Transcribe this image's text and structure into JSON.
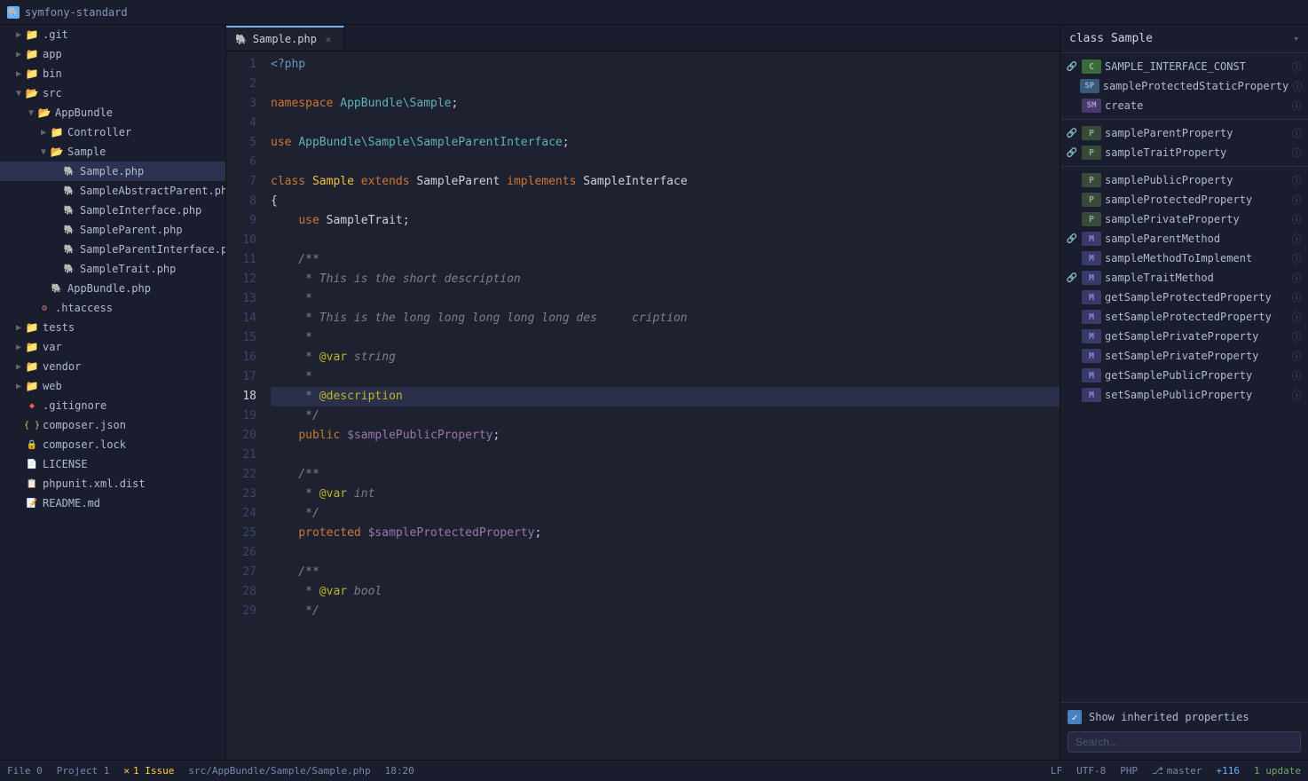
{
  "titleBar": {
    "icon": "🐘",
    "title": "symfony-standard"
  },
  "sidebar": {
    "items": [
      {
        "id": "git",
        "label": ".git",
        "indent": 1,
        "type": "folder",
        "collapsed": true,
        "arrow": "▶"
      },
      {
        "id": "app",
        "label": "app",
        "indent": 1,
        "type": "folder",
        "collapsed": true,
        "arrow": "▶"
      },
      {
        "id": "bin",
        "label": "bin",
        "indent": 1,
        "type": "folder",
        "collapsed": true,
        "arrow": "▶"
      },
      {
        "id": "src",
        "label": "src",
        "indent": 1,
        "type": "folder-open",
        "collapsed": false,
        "arrow": "▼"
      },
      {
        "id": "appbundle",
        "label": "AppBundle",
        "indent": 2,
        "type": "folder-open",
        "collapsed": false,
        "arrow": "▼"
      },
      {
        "id": "controller",
        "label": "Controller",
        "indent": 3,
        "type": "folder",
        "collapsed": true,
        "arrow": "▶"
      },
      {
        "id": "sample-dir",
        "label": "Sample",
        "indent": 3,
        "type": "folder-open",
        "collapsed": false,
        "arrow": "▼"
      },
      {
        "id": "sample-php",
        "label": "Sample.php",
        "indent": 4,
        "type": "php",
        "active": true
      },
      {
        "id": "sampleabstractparent",
        "label": "SampleAbstractParent.php",
        "indent": 4,
        "type": "php"
      },
      {
        "id": "sampleinterface",
        "label": "SampleInterface.php",
        "indent": 4,
        "type": "php"
      },
      {
        "id": "sampleparent",
        "label": "SampleParent.php",
        "indent": 4,
        "type": "php"
      },
      {
        "id": "sampleparentinterface",
        "label": "SampleParentInterface.php",
        "indent": 4,
        "type": "php"
      },
      {
        "id": "sampletrait",
        "label": "SampleTrait.php",
        "indent": 4,
        "type": "php"
      },
      {
        "id": "appbundle-php",
        "label": "AppBundle.php",
        "indent": 3,
        "type": "php"
      },
      {
        "id": "htaccess",
        "label": ".htaccess",
        "indent": 2,
        "type": "htaccess"
      },
      {
        "id": "tests",
        "label": "tests",
        "indent": 1,
        "type": "folder",
        "collapsed": true,
        "arrow": "▶"
      },
      {
        "id": "var",
        "label": "var",
        "indent": 1,
        "type": "folder",
        "collapsed": true,
        "arrow": "▶"
      },
      {
        "id": "vendor",
        "label": "vendor",
        "indent": 1,
        "type": "folder",
        "collapsed": true,
        "arrow": "▶"
      },
      {
        "id": "web",
        "label": "web",
        "indent": 1,
        "type": "folder",
        "collapsed": true,
        "arrow": "▶"
      },
      {
        "id": "gitignore",
        "label": ".gitignore",
        "indent": 1,
        "type": "git"
      },
      {
        "id": "composerjson",
        "label": "composer.json",
        "indent": 1,
        "type": "json"
      },
      {
        "id": "composerlock",
        "label": "composer.lock",
        "indent": 1,
        "type": "lock"
      },
      {
        "id": "license",
        "label": "LICENSE",
        "indent": 1,
        "type": "txt"
      },
      {
        "id": "phpunit",
        "label": "phpunit.xml.dist",
        "indent": 1,
        "type": "xml"
      },
      {
        "id": "readme",
        "label": "README.md",
        "indent": 1,
        "type": "md"
      }
    ]
  },
  "tabs": [
    {
      "id": "sample-php",
      "label": "Sample.php",
      "active": true,
      "icon": "🐘"
    }
  ],
  "codeLines": [
    {
      "num": 1,
      "content": "<?php",
      "tokens": [
        {
          "type": "tag",
          "text": "<?php"
        }
      ]
    },
    {
      "num": 2,
      "content": "",
      "tokens": []
    },
    {
      "num": 3,
      "content": "namespace AppBundle\\Sample;",
      "tokens": [
        {
          "type": "kw",
          "text": "namespace"
        },
        {
          "type": "plain",
          "text": " "
        },
        {
          "type": "ns",
          "text": "AppBundle\\Sample"
        },
        {
          "type": "plain",
          "text": ";"
        }
      ]
    },
    {
      "num": 4,
      "content": "",
      "tokens": []
    },
    {
      "num": 5,
      "content": "use AppBundle\\Sample\\SampleParentInterface;",
      "tokens": [
        {
          "type": "kw",
          "text": "use"
        },
        {
          "type": "plain",
          "text": " "
        },
        {
          "type": "ns",
          "text": "AppBundle\\Sample\\SampleParentInterface"
        },
        {
          "type": "plain",
          "text": ";"
        }
      ]
    },
    {
      "num": 6,
      "content": "",
      "tokens": []
    },
    {
      "num": 7,
      "content": "class Sample extends SampleParent implements SampleInterface",
      "tokens": [
        {
          "type": "kw",
          "text": "class"
        },
        {
          "type": "plain",
          "text": " "
        },
        {
          "type": "cls",
          "text": "Sample"
        },
        {
          "type": "plain",
          "text": " "
        },
        {
          "type": "kw",
          "text": "extends"
        },
        {
          "type": "plain",
          "text": " SampleParent "
        },
        {
          "type": "kw",
          "text": "implements"
        },
        {
          "type": "plain",
          "text": " SampleInterface"
        }
      ]
    },
    {
      "num": 8,
      "content": "{",
      "tokens": [
        {
          "type": "plain",
          "text": "{"
        }
      ]
    },
    {
      "num": 9,
      "content": "    use SampleTrait;",
      "tokens": [
        {
          "type": "plain",
          "text": "    "
        },
        {
          "type": "kw",
          "text": "use"
        },
        {
          "type": "plain",
          "text": " SampleTrait;"
        }
      ]
    },
    {
      "num": 10,
      "content": "",
      "tokens": []
    },
    {
      "num": 11,
      "content": "    /**",
      "tokens": [
        {
          "type": "cmnt",
          "text": "    /**"
        }
      ]
    },
    {
      "num": 12,
      "content": "     * This is the short description",
      "tokens": [
        {
          "type": "cmnt",
          "text": "     * This is the short description"
        }
      ]
    },
    {
      "num": 13,
      "content": "     *",
      "tokens": [
        {
          "type": "cmnt",
          "text": "     *"
        }
      ]
    },
    {
      "num": 14,
      "content": "     * This is the long long long long long des     cription",
      "tokens": [
        {
          "type": "cmnt",
          "text": "     * This is the long long long long long des     cription"
        }
      ]
    },
    {
      "num": 15,
      "content": "     *",
      "tokens": [
        {
          "type": "cmnt",
          "text": "     *"
        }
      ]
    },
    {
      "num": 16,
      "content": "     * @var string",
      "tokens": [
        {
          "type": "cmnt",
          "text": "     * "
        },
        {
          "type": "ann",
          "text": "@var"
        },
        {
          "type": "cmnt",
          "text": " string"
        }
      ]
    },
    {
      "num": 17,
      "content": "     *",
      "tokens": [
        {
          "type": "cmnt",
          "text": "     *"
        }
      ]
    },
    {
      "num": 18,
      "content": "     * @description",
      "tokens": [
        {
          "type": "cmnt",
          "text": "     * "
        },
        {
          "type": "ann",
          "text": "@description"
        }
      ],
      "highlighted": true
    },
    {
      "num": 19,
      "content": "     */",
      "tokens": [
        {
          "type": "cmnt",
          "text": "     */"
        }
      ]
    },
    {
      "num": 20,
      "content": "    public $samplePublicProperty;",
      "tokens": [
        {
          "type": "plain",
          "text": "    "
        },
        {
          "type": "kw",
          "text": "public"
        },
        {
          "type": "plain",
          "text": " "
        },
        {
          "type": "var",
          "text": "$samplePublicProperty"
        },
        {
          "type": "plain",
          "text": ";"
        }
      ]
    },
    {
      "num": 21,
      "content": "",
      "tokens": []
    },
    {
      "num": 22,
      "content": "    /**",
      "tokens": [
        {
          "type": "cmnt",
          "text": "    /**"
        }
      ]
    },
    {
      "num": 23,
      "content": "     * @var int",
      "tokens": [
        {
          "type": "cmnt",
          "text": "     * "
        },
        {
          "type": "ann",
          "text": "@var"
        },
        {
          "type": "cmnt",
          "text": " int"
        }
      ]
    },
    {
      "num": 24,
      "content": "     */",
      "tokens": [
        {
          "type": "cmnt",
          "text": "     */"
        }
      ]
    },
    {
      "num": 25,
      "content": "    protected $sampleProtectedProperty;",
      "tokens": [
        {
          "type": "plain",
          "text": "    "
        },
        {
          "type": "kw",
          "text": "protected"
        },
        {
          "type": "plain",
          "text": " "
        },
        {
          "type": "var",
          "text": "$sampleProtectedProperty"
        },
        {
          "type": "plain",
          "text": ";"
        }
      ]
    },
    {
      "num": 26,
      "content": "",
      "tokens": []
    },
    {
      "num": 27,
      "content": "    /**",
      "tokens": [
        {
          "type": "cmnt",
          "text": "    /**"
        }
      ]
    },
    {
      "num": 28,
      "content": "     * @var bool",
      "tokens": [
        {
          "type": "cmnt",
          "text": "     * "
        },
        {
          "type": "ann",
          "text": "@var"
        },
        {
          "type": "cmnt",
          "text": " bool"
        }
      ]
    },
    {
      "num": 29,
      "content": "     */",
      "tokens": [
        {
          "type": "cmnt",
          "text": "     */"
        }
      ]
    }
  ],
  "rightPanel": {
    "title": "class Sample",
    "symbols": [
      {
        "id": "SAMPLE_INTERFACE_CONST",
        "badge": "C",
        "badgeClass": "badge-c",
        "name": "SAMPLE_INTERFACE_CONST",
        "hasLink": true,
        "hasInfo": true
      },
      {
        "id": "sampleProtectedStaticProperty",
        "badge": "SP",
        "badgeClass": "badge-sp",
        "name": "sampleProtectedStaticProperty",
        "hasLink": false,
        "hasInfo": true
      },
      {
        "id": "create",
        "badge": "SM",
        "badgeClass": "badge-sm",
        "name": "create",
        "hasLink": false,
        "hasInfo": true
      },
      {
        "id": "sampleParentProperty",
        "badge": "P",
        "badgeClass": "badge-p",
        "name": "sampleParentProperty",
        "hasLink": true,
        "hasInfo": true
      },
      {
        "id": "sampleTraitProperty",
        "badge": "P",
        "badgeClass": "badge-p",
        "name": "sampleTraitProperty",
        "hasLink": true,
        "hasInfo": true
      },
      {
        "id": "samplePublicProperty",
        "badge": "P",
        "badgeClass": "badge-p",
        "name": "samplePublicProperty",
        "hasLink": false,
        "hasInfo": true
      },
      {
        "id": "sampleProtectedProperty",
        "badge": "P",
        "badgeClass": "badge-p",
        "name": "sampleProtectedProperty",
        "hasLink": false,
        "hasInfo": true
      },
      {
        "id": "samplePrivateProperty",
        "badge": "P",
        "badgeClass": "badge-p",
        "name": "samplePrivateProperty",
        "hasLink": false,
        "hasInfo": true
      },
      {
        "id": "sampleParentMethod",
        "badge": "M",
        "badgeClass": "badge-m",
        "name": "sampleParentMethod",
        "hasLink": true,
        "hasInfo": true
      },
      {
        "id": "sampleMethodToImplement",
        "badge": "M",
        "badgeClass": "badge-m",
        "name": "sampleMethodToImplement",
        "hasLink": false,
        "hasInfo": true
      },
      {
        "id": "sampleTraitMethod",
        "badge": "M",
        "badgeClass": "badge-m",
        "name": "sampleTraitMethod",
        "hasLink": true,
        "hasInfo": true
      },
      {
        "id": "getSampleProtectedProperty",
        "badge": "M",
        "badgeClass": "badge-m",
        "name": "getSampleProtectedProperty",
        "hasLink": false,
        "hasInfo": true
      },
      {
        "id": "setSampleProtectedProperty",
        "badge": "M",
        "badgeClass": "badge-m",
        "name": "setSampleProtectedProperty",
        "hasLink": false,
        "hasInfo": true
      },
      {
        "id": "getSamplePrivateProperty",
        "badge": "M",
        "badgeClass": "badge-m",
        "name": "getSamplePrivateProperty",
        "hasLink": false,
        "hasInfo": true
      },
      {
        "id": "setSamplePrivateProperty",
        "badge": "M",
        "badgeClass": "badge-m",
        "name": "setSamplePrivateProperty",
        "hasLink": false,
        "hasInfo": true
      },
      {
        "id": "getSamplePublicProperty",
        "badge": "M",
        "badgeClass": "badge-m",
        "name": "getSamplePublicProperty",
        "hasLink": false,
        "hasInfo": true
      },
      {
        "id": "setSamplePublicProperty",
        "badge": "M",
        "badgeClass": "badge-m",
        "name": "setSamplePublicProperty",
        "hasLink": false,
        "hasInfo": true
      }
    ],
    "showInherited": {
      "label": "Show inherited properties",
      "checked": true
    },
    "search": {
      "placeholder": "Search..."
    }
  },
  "statusBar": {
    "file": "File 0",
    "project": "Project 1",
    "issues": "1 Issue",
    "path": "src/AppBundle/Sample/Sample.php",
    "position": "18:20",
    "encoding": "LF",
    "charset": "UTF-8",
    "language": "PHP",
    "vcs": "master",
    "changes": "+116",
    "updates": "1 update"
  }
}
